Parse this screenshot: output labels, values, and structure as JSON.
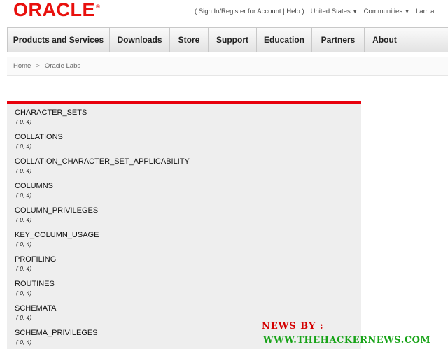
{
  "header": {
    "logo": "ORACLE",
    "logo_mark": "®",
    "links": [
      {
        "label": "( Sign In/Register for Account | Help )",
        "caret": false
      },
      {
        "label": "United States",
        "caret": true
      },
      {
        "label": "Communities",
        "caret": true
      },
      {
        "label": "I am a",
        "caret": false
      }
    ],
    "caret_icon": "▼"
  },
  "nav": {
    "items": [
      {
        "label": "Products and Services",
        "width": 146
      },
      {
        "label": "Downloads",
        "width": 86
      },
      {
        "label": "Store",
        "width": 55
      },
      {
        "label": "Support",
        "width": 69
      },
      {
        "label": "Education",
        "width": 79
      },
      {
        "label": "Partners",
        "width": 75
      },
      {
        "label": "About",
        "width": 58
      }
    ]
  },
  "breadcrumb": {
    "home": "Home",
    "separator": ">",
    "current": "Oracle Labs"
  },
  "tables": [
    {
      "name": "CHARACTER_SETS",
      "info": "( 0, 4)"
    },
    {
      "name": "COLLATIONS",
      "info": "( 0, 4)"
    },
    {
      "name": "COLLATION_CHARACTER_SET_APPLICABILITY",
      "info": "( 0, 4)"
    },
    {
      "name": "COLUMNS",
      "info": "( 0, 4)"
    },
    {
      "name": "COLUMN_PRIVILEGES",
      "info": "( 0, 4)"
    },
    {
      "name": "KEY_COLUMN_USAGE",
      "info": "( 0, 4)"
    },
    {
      "name": "PROFILING",
      "info": "( 0, 4)"
    },
    {
      "name": "ROUTINES",
      "info": "( 0, 4)"
    },
    {
      "name": "SCHEMATA",
      "info": "( 0, 4)"
    },
    {
      "name": "SCHEMA_PRIVILEGES",
      "info": "( 0, 4)"
    }
  ],
  "watermark": {
    "line1": "NEWS BY :",
    "line2": "WWW.THEHACKERNEWS.COM"
  },
  "colors": {
    "brand_red": "#e8100d",
    "accent_bar": "#e8000c",
    "watermark_red": "#d40000",
    "watermark_green": "#17a317"
  }
}
